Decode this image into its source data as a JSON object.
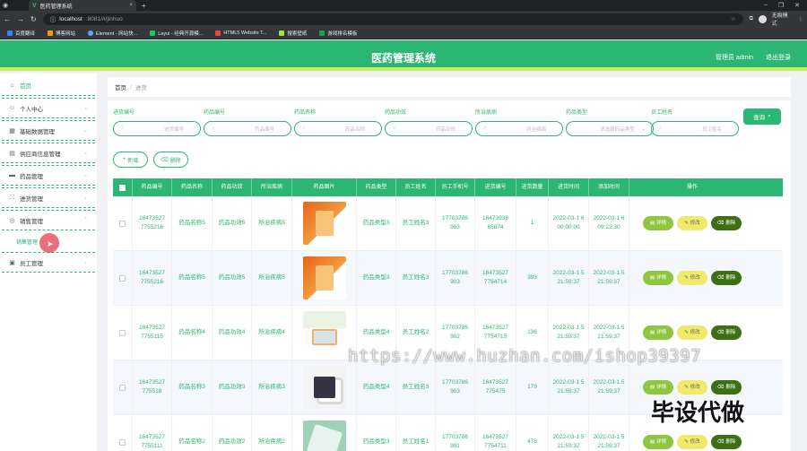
{
  "browser": {
    "tab_title": "医药管理系统",
    "url_host": "localhost",
    "url_rest": ":8081/#/jinhuo",
    "profile_label": "无痕模式",
    "bookmarks": [
      "百度翻译",
      "博客网站",
      "Element - 网站快...",
      "Layui - 经典开源模...",
      "HTML5 Website T...",
      "搜索壁纸",
      "游戏排名模板"
    ]
  },
  "header": {
    "title": "医药管理系统",
    "user": "管理员 admin",
    "logout": "退出登录"
  },
  "sidebar": {
    "items": [
      {
        "label": "首页",
        "icon": "home-icon"
      },
      {
        "label": "个人中心",
        "icon": "user-icon"
      },
      {
        "label": "基础数据管理",
        "icon": "database-icon"
      },
      {
        "label": "供应商信息管理",
        "icon": "supplier-icon"
      },
      {
        "label": "药品管理",
        "icon": "medicine-icon"
      },
      {
        "label": "进货管理",
        "icon": "purchase-icon"
      },
      {
        "label": "销售管理",
        "icon": "sales-icon"
      },
      {
        "label": "员工管理",
        "icon": "staff-icon"
      }
    ],
    "sub_item": "销售管理"
  },
  "breadcrumb": {
    "home": "首页",
    "sep": "/",
    "current": "进货"
  },
  "filters": [
    {
      "label": "进货编号",
      "placeholder": "进货编号"
    },
    {
      "label": "药品编号",
      "placeholder": "药品编号"
    },
    {
      "label": "药品名称",
      "placeholder": "药品名称"
    },
    {
      "label": "药品功效",
      "placeholder": "药品功效"
    },
    {
      "label": "所治病病",
      "placeholder": "所治病病"
    },
    {
      "label": "药品类型",
      "placeholder": "请选择药品类型"
    },
    {
      "label": "员工姓名",
      "placeholder": "员工姓名"
    }
  ],
  "buttons": {
    "search": "查询",
    "add": "新增",
    "delete": "删除"
  },
  "table": {
    "headers": [
      "药品编号",
      "药品名称",
      "药品功效",
      "所治疾病",
      "药品图片",
      "药品类型",
      "员工姓名",
      "员工手机号",
      "进货编号",
      "进货数量",
      "进货时间",
      "添加时间",
      "操作"
    ],
    "rows": [
      {
        "drug_no": "16473527 7755216",
        "name": "药品名称5",
        "effect": "药品功效5",
        "disease": "所治疾病5",
        "type": "药品类型3",
        "staff": "员工姓名3",
        "phone": "17703786 903",
        "purchase_no": "16473936 65874",
        "qty": "1",
        "ptime": "2022-03-1 6 00:00:00",
        "atime": "2022-03-1 6 09:22:30"
      },
      {
        "drug_no": "16473527 7755216",
        "name": "药品名称5",
        "effect": "药品功效5",
        "disease": "所治疾病5",
        "type": "药品类型3",
        "staff": "员工姓名3",
        "phone": "17703786 903",
        "purchase_no": "16473527 7754714",
        "qty": "393",
        "ptime": "2022-03-1 5 21:59:37",
        "atime": "2022-03-1 5 21:59:37"
      },
      {
        "drug_no": "16473527 7755115",
        "name": "药品名称4",
        "effect": "药品功效4",
        "disease": "所治疾病4",
        "type": "药品类型4",
        "staff": "员工姓名2",
        "phone": "17703786 902",
        "purchase_no": "16473527 7754715",
        "qty": "136",
        "ptime": "2022-03-1 5 21:59:37",
        "atime": "2022-03-1 5 21:59:37"
      },
      {
        "drug_no": "16473527 775518",
        "name": "药品名称3",
        "effect": "药品功效3",
        "disease": "所治疾病3",
        "type": "药品类型4",
        "staff": "员工姓名3",
        "phone": "17703786 903",
        "purchase_no": "16473527 775475",
        "qty": "179",
        "ptime": "2022-03-1 5 21:59:37",
        "atime": "2022-03-1 5 21:59:37"
      },
      {
        "drug_no": "16473527 7755111",
        "name": "药品名称2",
        "effect": "药品功效2",
        "disease": "所治疾病2",
        "type": "药品类型3",
        "staff": "员工姓名1",
        "phone": "17703786 901",
        "purchase_no": "16473527 7754711",
        "qty": "478",
        "ptime": "2022-03-1 5 21:59:37",
        "atime": "2022-03-1 5 21:59:37"
      }
    ],
    "row_actions": {
      "detail": "详情",
      "edit": "修改",
      "delete": "删除"
    }
  },
  "watermark": "https://www.huzhan.com/ishop39397",
  "watermark_cn": "毕设代做",
  "colors": {
    "primary": "#2bb673",
    "accent_bar": "#c8f05a",
    "detail": "#8ec63f",
    "edit": "#f0ea6b",
    "delete": "#3d6f14"
  }
}
